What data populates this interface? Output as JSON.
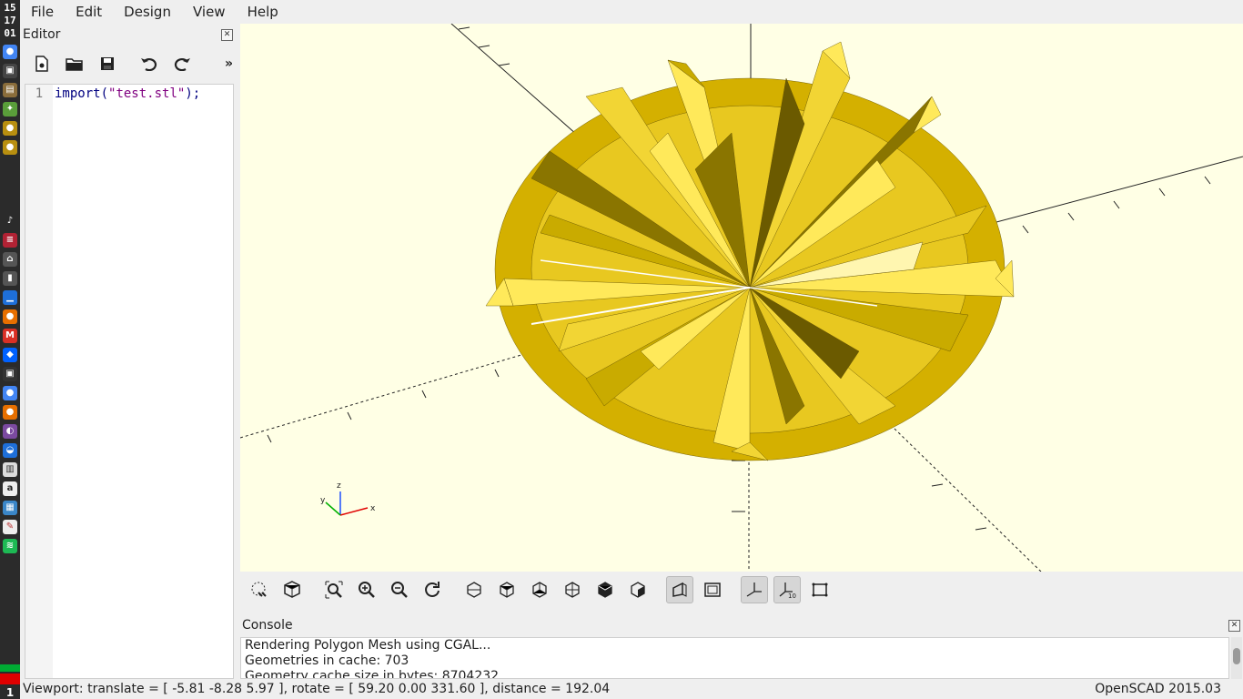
{
  "dock": {
    "clock_lines": [
      "15",
      "17",
      "01"
    ],
    "workspace_number": "1",
    "icons": [
      "chrome-icon",
      "terminal-icon",
      "files-icon",
      "leaf-icon",
      "ball-icon",
      "ball-icon-2",
      "volume-icon",
      "flag-icon",
      "lock-icon",
      "battery-icon",
      "signal-icon",
      "firefox-icon",
      "gmail-icon",
      "dropbox-icon",
      "terminal-icon-2",
      "chrome-icon-2",
      "firefox-icon-2",
      "pidgin-icon",
      "thunderbird-icon",
      "printer-icon",
      "amazon-icon",
      "monitor-icon",
      "editor-icon",
      "spotify-icon"
    ]
  },
  "menubar": {
    "items": [
      "File",
      "Edit",
      "Design",
      "View",
      "Help"
    ]
  },
  "editor": {
    "title": "Editor",
    "line_number": "1",
    "code_fn": "import(",
    "code_str": "\"test.stl\"",
    "code_end": ");"
  },
  "console": {
    "title": "Console",
    "lines": [
      "Rendering Polygon Mesh using CGAL...",
      "Geometries in cache: 703",
      "Geometry cache size in bytes: 8704232"
    ]
  },
  "axis_labels": {
    "z": "z",
    "x": "x",
    "y": "y"
  },
  "statusbar": {
    "viewport_info": "Viewport: translate = [ -5.81 -8.28 5.97 ], rotate = [ 59.20 0.00 331.60 ], distance = 192.04",
    "version": "OpenSCAD 2015.03"
  },
  "colors": {
    "viewport_bg": "#ffffe5",
    "model": "#e8c820",
    "model_dark": "#6b5a00",
    "model_light": "#ffe95a"
  }
}
